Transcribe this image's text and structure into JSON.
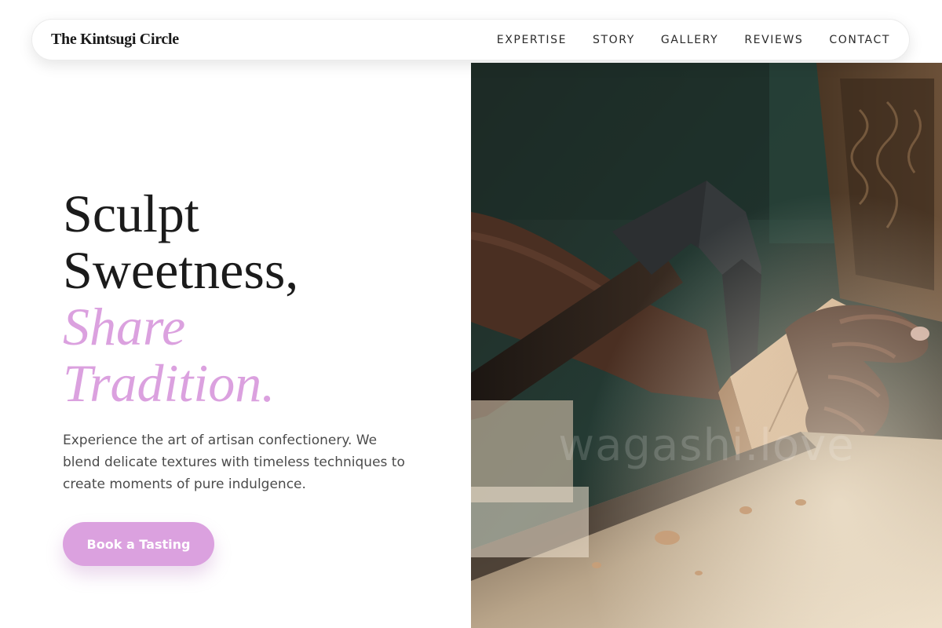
{
  "brand": {
    "name": "The Kintsugi Circle"
  },
  "nav": {
    "items": [
      {
        "label": "EXPERTISE"
      },
      {
        "label": "STORY"
      },
      {
        "label": "GALLERY"
      },
      {
        "label": "REVIEWS"
      },
      {
        "label": "CONTACT"
      }
    ]
  },
  "hero": {
    "headline": {
      "line1": "Sculpt",
      "line2": "Sweetness,",
      "accent1": "Share",
      "accent2": "Tradition."
    },
    "lead": "Experience the art of artisan confectionery. We blend delicate textures with timeless techniques to create moments of pure indulgence.",
    "cta_label": "Book a Tasting",
    "image": {
      "watermark": "wagashi.love",
      "alt_icon": "woodcarving-photo"
    }
  },
  "colors": {
    "accent": "#dba1df",
    "text_dark": "#1b1b1b",
    "text_body": "#4b4b4b",
    "background": "#ffffff"
  }
}
